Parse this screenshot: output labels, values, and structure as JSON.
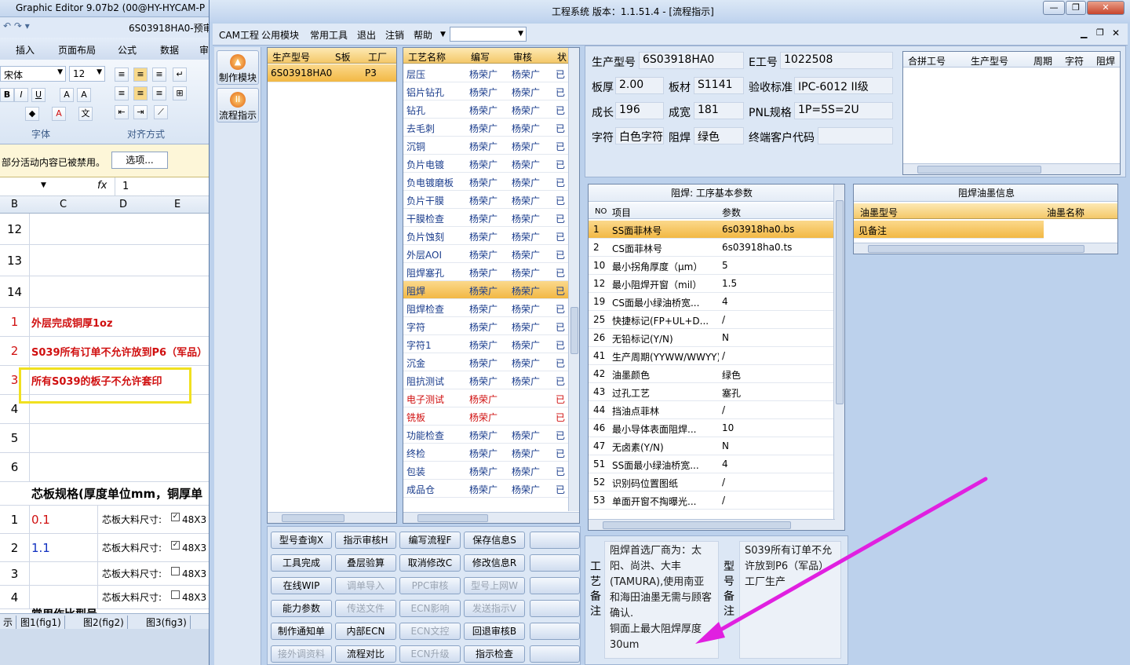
{
  "excel": {
    "title": "Graphic Editor 9.07b2 (00@HY-HYCAM-P",
    "doc_name": "6S03918HA0-预审",
    "tabs": [
      "插入",
      "页面布局",
      "公式",
      "数据",
      "审"
    ],
    "font_name": "宋体",
    "font_size": "12",
    "group_font": "字体",
    "group_align": "对齐方式",
    "security_msg": "部分活动内容已被禁用。",
    "options_btn": "选项...",
    "formula_value": "1",
    "columns": [
      "B",
      "C",
      "D",
      "E"
    ],
    "rows": [
      {
        "num": "12",
        "text": "",
        "num_color": "#000000",
        "text_color": "#000000"
      },
      {
        "num": "13",
        "text": "",
        "num_color": "#000000",
        "text_color": "#000000"
      },
      {
        "num": "14",
        "text": "",
        "num_color": "#000000",
        "text_color": "#000000"
      },
      {
        "num": "1",
        "text": "外层完成铜厚1oz",
        "num_color": "#d01010",
        "text_color": "#d01010"
      },
      {
        "num": "2",
        "text": "S039所有订单不允许放到P6（军品）",
        "num_color": "#d01010",
        "text_color": "#d01010"
      },
      {
        "num": "3",
        "text": "所有S039的板子不允许套印",
        "num_color": "#d01010",
        "text_color": "#d01010"
      },
      {
        "num": "4",
        "text": "",
        "num_color": "#000000",
        "text_color": "#000000"
      },
      {
        "num": "5",
        "text": "",
        "num_color": "#000000",
        "text_color": "#000000"
      },
      {
        "num": "6",
        "text": "",
        "num_color": "#000000",
        "text_color": "#000000"
      }
    ],
    "core_heading": "芯板规格(厚度单位mm，铜厚单",
    "core_rows": [
      {
        "num": "1",
        "value": "0.1",
        "value_color": "#d01010",
        "label": "芯板大料尺寸:",
        "checked": true,
        "size": "48X3"
      },
      {
        "num": "2",
        "value": "1.1",
        "value_color": "#1030c0",
        "label": "芯板大料尺寸:",
        "checked": true,
        "size": "48X3"
      },
      {
        "num": "3",
        "value": "",
        "value_color": "#000000",
        "label": "芯板大料尺寸:",
        "checked": false,
        "size": "48X3"
      },
      {
        "num": "4",
        "value": "",
        "value_color": "#000000",
        "label": "芯板大料尺寸:",
        "checked": false,
        "size": "48X3"
      }
    ],
    "partial_row": "常用作比型号",
    "sheet_tabs": [
      "示",
      "图1(fig1)",
      "图2(fig2)",
      "图3(fig3)"
    ]
  },
  "main": {
    "title": "工程系统   版本：1.1.51.4 - [流程指示]",
    "menu": [
      "CAM工程",
      "公用模块",
      "常用工具",
      "退出",
      "注销",
      "帮助"
    ],
    "nav": [
      {
        "label": "制作模块",
        "icon": "fire-icon"
      },
      {
        "label": "流程指示",
        "icon": "pause-icon"
      }
    ],
    "model_grid": {
      "headers": [
        "生产型号",
        "S板",
        "工厂"
      ],
      "rows": [
        {
          "model": "6S03918HA0",
          "s": "",
          "factory": "P3"
        }
      ]
    },
    "process_grid": {
      "headers": [
        "工艺名称",
        "编写",
        "审核",
        "状"
      ],
      "rows": [
        {
          "name": "层压",
          "writer": "杨荣广",
          "checker": "杨荣广",
          "st": "已",
          "red": false
        },
        {
          "name": "铝片钻孔",
          "writer": "杨荣广",
          "checker": "杨荣广",
          "st": "已",
          "red": false
        },
        {
          "name": "钻孔",
          "writer": "杨荣广",
          "checker": "杨荣广",
          "st": "已",
          "red": false
        },
        {
          "name": "去毛刺",
          "writer": "杨荣广",
          "checker": "杨荣广",
          "st": "已",
          "red": false
        },
        {
          "name": "沉铜",
          "writer": "杨荣广",
          "checker": "杨荣广",
          "st": "已",
          "red": false
        },
        {
          "name": "负片电镀",
          "writer": "杨荣广",
          "checker": "杨荣广",
          "st": "已",
          "red": false
        },
        {
          "name": "负电镀磨板",
          "writer": "杨荣广",
          "checker": "杨荣广",
          "st": "已",
          "red": false
        },
        {
          "name": "负片干膜",
          "writer": "杨荣广",
          "checker": "杨荣广",
          "st": "已",
          "red": false
        },
        {
          "name": "干膜检查",
          "writer": "杨荣广",
          "checker": "杨荣广",
          "st": "已",
          "red": false
        },
        {
          "name": "负片蚀刻",
          "writer": "杨荣广",
          "checker": "杨荣广",
          "st": "已",
          "red": false
        },
        {
          "name": "外层AOI",
          "writer": "杨荣广",
          "checker": "杨荣广",
          "st": "已",
          "red": false
        },
        {
          "name": "阻焊塞孔",
          "writer": "杨荣广",
          "checker": "杨荣广",
          "st": "已",
          "red": false
        },
        {
          "name": "阻焊",
          "writer": "杨荣广",
          "checker": "杨荣广",
          "st": "已",
          "red": false,
          "selected": true
        },
        {
          "name": "阻焊检查",
          "writer": "杨荣广",
          "checker": "杨荣广",
          "st": "已",
          "red": false
        },
        {
          "name": "字符",
          "writer": "杨荣广",
          "checker": "杨荣广",
          "st": "已",
          "red": false
        },
        {
          "name": "字符1",
          "writer": "杨荣广",
          "checker": "杨荣广",
          "st": "已",
          "red": false
        },
        {
          "name": "沉金",
          "writer": "杨荣广",
          "checker": "杨荣广",
          "st": "已",
          "red": false
        },
        {
          "name": "阻抗测试",
          "writer": "杨荣广",
          "checker": "杨荣广",
          "st": "已",
          "red": false
        },
        {
          "name": "电子测试",
          "writer": "杨荣广",
          "checker": "",
          "st": "已",
          "red": true
        },
        {
          "name": "铣板",
          "writer": "杨荣广",
          "checker": "",
          "st": "已",
          "red": true
        },
        {
          "name": "功能检查",
          "writer": "杨荣广",
          "checker": "杨荣广",
          "st": "已",
          "red": false
        },
        {
          "name": "终检",
          "writer": "杨荣广",
          "checker": "杨荣广",
          "st": "已",
          "red": false
        },
        {
          "name": "包装",
          "writer": "杨荣广",
          "checker": "杨荣广",
          "st": "已",
          "red": false
        },
        {
          "name": "成品仓",
          "writer": "杨荣广",
          "checker": "杨荣广",
          "st": "已",
          "red": false
        }
      ]
    },
    "info": {
      "model_label": "生产型号",
      "model_value": "6S03918HA0",
      "eno_label": "E工号",
      "eno_value": "1022508",
      "thick_label": "板厚",
      "thick_value": "2.00",
      "mat_label": "板材",
      "mat_value": "S1141",
      "std_label": "验收标准",
      "std_value": "IPC-6012 II级",
      "len_label": "成长",
      "len_value": "196",
      "wid_label": "成宽",
      "wid_value": "181",
      "pnl_label": "PNL规格",
      "pnl_value": "1P=5S=2U",
      "char_label": "字符",
      "char_value": "白色字符",
      "mask_label": "阻焊",
      "mask_value": "绿色",
      "cust_label": "终端客户代码",
      "cust_value": ""
    },
    "merge_grid": {
      "headers": [
        "合拼工号",
        "生产型号",
        "周期",
        "字符",
        "阻焊"
      ]
    },
    "params": {
      "title": "阻焊: 工序基本参数",
      "headers": [
        "NO",
        "项目",
        "参数"
      ],
      "rows": [
        {
          "no": "1",
          "item": "SS面菲林号",
          "value": "6s03918ha0.bs"
        },
        {
          "no": "2",
          "item": "CS面菲林号",
          "value": "6s03918ha0.ts"
        },
        {
          "no": "10",
          "item": "最小拐角厚度（μm）",
          "value": "5"
        },
        {
          "no": "12",
          "item": "最小阻焊开窗（mil）",
          "value": "1.5"
        },
        {
          "no": "19",
          "item": "CS面最小绿油桥宽...",
          "value": "4"
        },
        {
          "no": "25",
          "item": "快捷标记(FP+UL+D...",
          "value": "/"
        },
        {
          "no": "26",
          "item": "无铅标记(Y/N)",
          "value": "N"
        },
        {
          "no": "41",
          "item": "生产周期(YYWW/WWYY)",
          "value": "/"
        },
        {
          "no": "42",
          "item": "油墨颜色",
          "value": "绿色"
        },
        {
          "no": "43",
          "item": "过孔工艺",
          "value": "塞孔"
        },
        {
          "no": "44",
          "item": "挡油点菲林",
          "value": "/"
        },
        {
          "no": "46",
          "item": "最小导体表面阻焊...",
          "value": "10"
        },
        {
          "no": "47",
          "item": "无卤素(Y/N)",
          "value": "N"
        },
        {
          "no": "51",
          "item": "SS面最小绿油桥宽...",
          "value": "4"
        },
        {
          "no": "52",
          "item": "识别码位置图纸",
          "value": "/"
        },
        {
          "no": "53",
          "item": "单面开窗不掏曝光...",
          "value": "/"
        }
      ]
    },
    "ink": {
      "title": "阻焊油墨信息",
      "headers": [
        "油墨型号",
        "油墨名称"
      ],
      "rows": [
        {
          "model": "见备注",
          "name": ""
        }
      ]
    },
    "buttons": [
      [
        {
          "label": "型号查询X",
          "disabled": false
        },
        {
          "label": "指示审核H",
          "disabled": false
        },
        {
          "label": "编写流程F",
          "disabled": false
        },
        {
          "label": "保存信息S",
          "disabled": false
        },
        {
          "label": "",
          "disabled": false
        }
      ],
      [
        {
          "label": "工具完成",
          "disabled": false
        },
        {
          "label": "叠层验算",
          "disabled": false
        },
        {
          "label": "取消修改C",
          "disabled": false
        },
        {
          "label": "修改信息R",
          "disabled": false
        },
        {
          "label": "",
          "disabled": false
        }
      ],
      [
        {
          "label": "在线WIP",
          "disabled": false
        },
        {
          "label": "调单导入",
          "disabled": true
        },
        {
          "label": "PPC审核",
          "disabled": true
        },
        {
          "label": "型号上网W",
          "disabled": true
        },
        {
          "label": "",
          "disabled": false
        }
      ],
      [
        {
          "label": "能力参数",
          "disabled": false
        },
        {
          "label": "传送文件",
          "disabled": true
        },
        {
          "label": "ECN影响",
          "disabled": true
        },
        {
          "label": "发送指示V",
          "disabled": true
        },
        {
          "label": "",
          "disabled": false
        }
      ],
      [
        {
          "label": "制作通知单",
          "disabled": false
        },
        {
          "label": "内部ECN",
          "disabled": false
        },
        {
          "label": "ECN文控",
          "disabled": true
        },
        {
          "label": "回退审核B",
          "disabled": false
        },
        {
          "label": "",
          "disabled": false
        }
      ],
      [
        {
          "label": "接外调资料",
          "disabled": true
        },
        {
          "label": "流程对比",
          "disabled": false
        },
        {
          "label": "ECN升级",
          "disabled": true
        },
        {
          "label": "指示检查",
          "disabled": false
        },
        {
          "label": "",
          "disabled": false
        }
      ]
    ],
    "remarks": {
      "process_label": "工艺备注",
      "process_text": "阻焊首选厂商为：太阳、尚洪、大丰(TAMURA),使用南亚和海田油墨无需与顾客确认.\n铜面上最大阻焊厚度30um",
      "model_label": "型号备注",
      "model_text": "S039所有订单不允许放到P6（军品）工厂生产"
    },
    "annotation_color": "#e020e0",
    "highlight_color": "#f0e020"
  }
}
